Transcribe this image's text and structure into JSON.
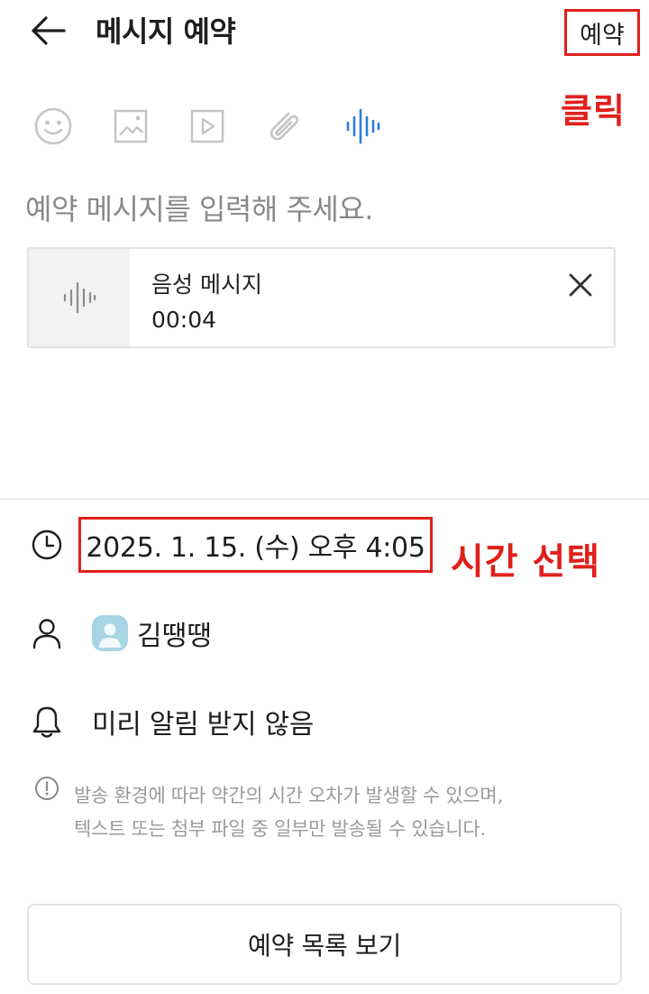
{
  "header": {
    "title": "메시지 예약",
    "reserve_label": "예약",
    "back_icon": "arrow-left-icon"
  },
  "annotations": {
    "click_label": "클릭",
    "time_label": "시간 선택",
    "color": "#e0201b"
  },
  "toolbar": {
    "icons": [
      "emoji-icon",
      "image-icon",
      "video-icon",
      "attachment-clip-icon",
      "voice-wave-icon"
    ],
    "active": "voice-wave-icon",
    "active_color": "#2b7fd6"
  },
  "message": {
    "placeholder": "예약 메시지를 입력해 주세요.",
    "value": ""
  },
  "voice_attachment": {
    "title": "음성 메시지",
    "duration": "00:04"
  },
  "schedule": {
    "datetime": "2025. 1. 15. (수) 오후 4:05"
  },
  "recipient": {
    "name": "김땡땡",
    "avatar_color": "#a9d4e4"
  },
  "alarm": {
    "label": "미리 알림 받지 않음"
  },
  "notice": {
    "line1": "발송 환경에 따라 약간의 시간 오차가 발생할 수 있으며,",
    "line2": "텍스트 또는 첨부 파일 중 일부만 발송될 수 있습니다."
  },
  "footer": {
    "list_button_label": "예약 목록 보기"
  }
}
